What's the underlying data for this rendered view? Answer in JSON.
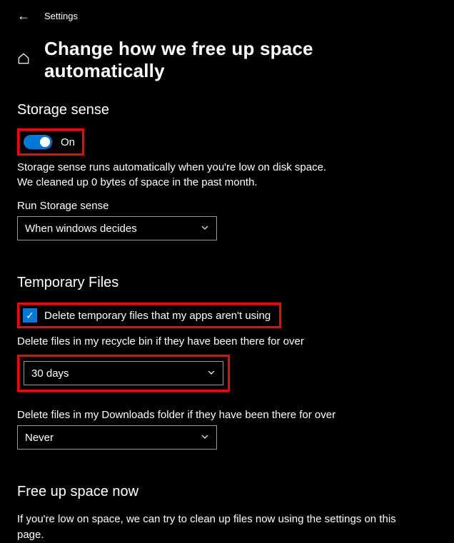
{
  "header": {
    "app_title": "Settings"
  },
  "page": {
    "title": "Change how we free up space automatically"
  },
  "storage_sense": {
    "heading": "Storage sense",
    "toggle_state": "On",
    "desc_line1": "Storage sense runs automatically when you're low on disk space.",
    "desc_line2": "We cleaned up 0 bytes of space in the past month.",
    "run_label": "Run Storage sense",
    "run_value": "When windows decides"
  },
  "temp_files": {
    "heading": "Temporary Files",
    "checkbox_label": "Delete temporary files that my apps aren't using",
    "recycle_label": "Delete files in my recycle bin if they have been there for over",
    "recycle_value": "30 days",
    "downloads_label": "Delete files in my Downloads folder if they have been there for over",
    "downloads_value": "Never"
  },
  "free_up": {
    "heading": "Free up space now",
    "body": "If you're low on space, we can try to clean up files now using the settings on this page."
  }
}
